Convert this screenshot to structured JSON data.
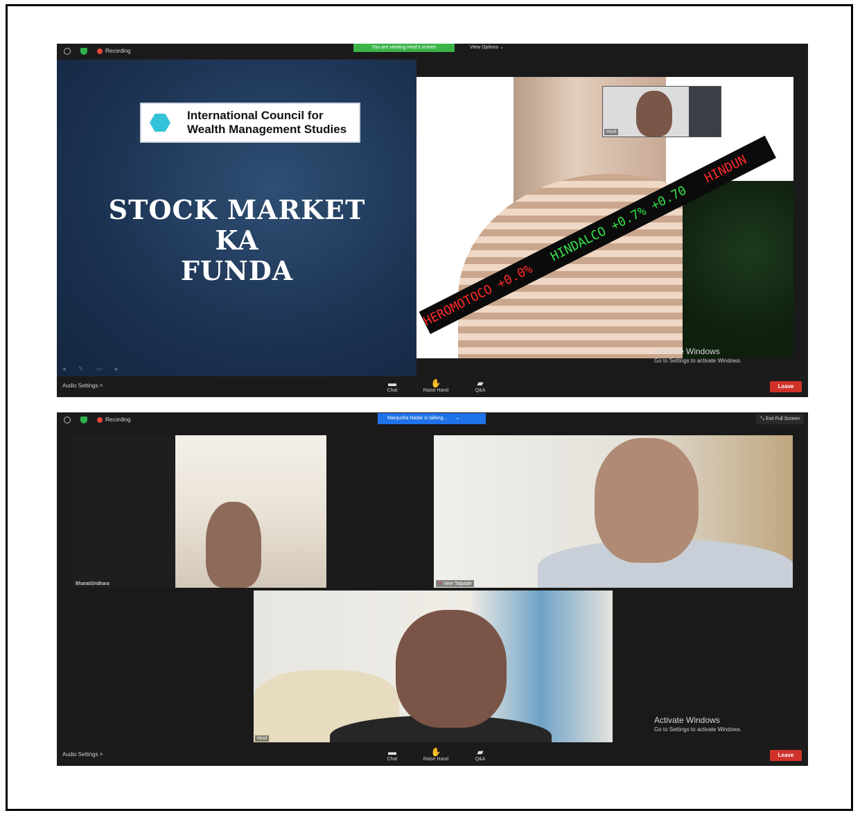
{
  "screenshot1": {
    "recording_label": "Recording",
    "viewing_banner": "You are viewing Host's screen",
    "view_options": "View Options",
    "slide": {
      "logo_line1": "International Council for",
      "logo_line2": "Wealth Management Studies",
      "title_line1": "STOCK MARKET",
      "title_line2": "KA",
      "title_line3": "FUNDA"
    },
    "ticker_text_red": "HEROMOTOCO +0.0%",
    "ticker_text_green": "HINDALCO +0.7%  +0.70",
    "ticker_text_red2": "HINDUN",
    "host_thumb_label": "Host",
    "activate_windows": "Activate Windows",
    "activate_windows_sub": "Go to Settings to activate Windows.",
    "bottom": {
      "audio_settings": "Audio Settings",
      "chat": "Chat",
      "raise_hand": "Raise Hand",
      "qa": "Q&A",
      "leave": "Leave"
    }
  },
  "screenshot2": {
    "recording_label": "Recording",
    "talking_banner": "Manjusha Nadar is talking...",
    "exit_full_screen": "Exit Full Screen",
    "participants": [
      {
        "name": "BharatiSridhara"
      },
      {
        "name": "Veer Talpade"
      },
      {
        "name": "Host"
      }
    ],
    "activate_windows": "Activate Windows",
    "activate_windows_sub": "Go to Settings to activate Windows.",
    "bottom": {
      "audio_settings": "Audio Settings",
      "chat": "Chat",
      "raise_hand": "Raise Hand",
      "qa": "Q&A",
      "leave": "Leave"
    }
  },
  "colors": {
    "leave_red": "#d0322a",
    "viewing_green": "#3cb44a",
    "talking_blue": "#1f72e8",
    "meeting_bg": "#1a1a1a"
  }
}
